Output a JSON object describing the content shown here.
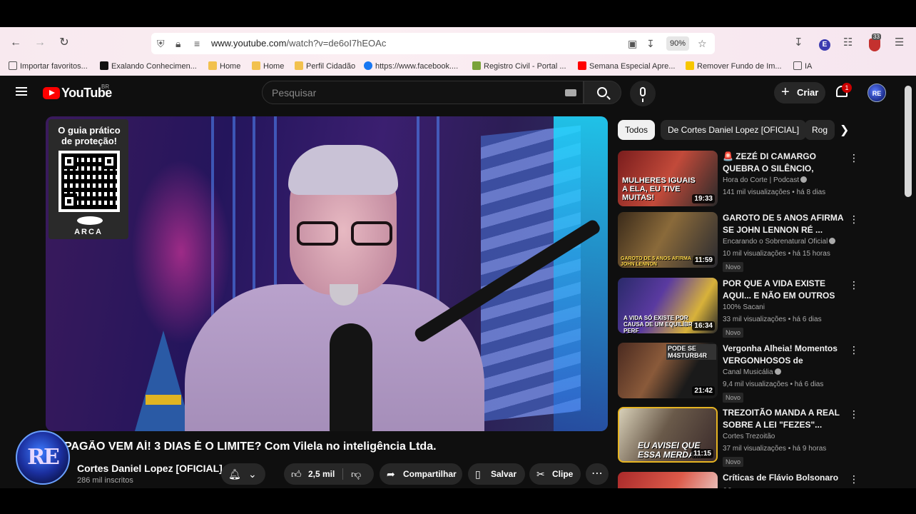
{
  "browser": {
    "url_domain": "www.youtube.com",
    "url_path": "/watch?v=de6oI7hEOAc",
    "zoom": "90%",
    "extension_badge_count": "33",
    "bookmarks": [
      {
        "label": "Importar favoritos...",
        "icon": "import-icon",
        "color": "#555555"
      },
      {
        "label": "Exalando Conhecimen...",
        "icon": "x-icon",
        "color": "#111111"
      },
      {
        "label": "Home",
        "icon": "hand-icon",
        "color": "#f2c14e"
      },
      {
        "label": "Home",
        "icon": "hand-icon",
        "color": "#f2c14e"
      },
      {
        "label": "Perfil Cidadão",
        "icon": "hand-icon",
        "color": "#f2c14e"
      },
      {
        "label": "https://www.facebook....",
        "icon": "facebook-icon",
        "color": "#1877f2"
      },
      {
        "label": "Registro Civil - Portal ...",
        "icon": "portal-icon",
        "color": "#7aa33a"
      },
      {
        "label": "Semana Especial Apre...",
        "icon": "youtube-icon",
        "color": "#ff0000"
      },
      {
        "label": "Remover Fundo de Im...",
        "icon": "remove-bg-icon",
        "color": "#f7c600"
      },
      {
        "label": "IA",
        "icon": "folder-icon",
        "color": "#555555"
      }
    ]
  },
  "youtube": {
    "logo_text": "YouTube",
    "region": "BR",
    "search_placeholder": "Pesquisar",
    "create_label": "Criar",
    "notification_count": "1",
    "avatar_text": "RE"
  },
  "video": {
    "title": "PAGÃO VEM AÍ! 3 DIAS É O LIMITE? Com Vilela no inteligência Ltda.",
    "overlay": {
      "card_title": "O guia prático de proteção!",
      "brand": "ARCA"
    },
    "channel_name": "Cortes Daniel Lopez [OFICIAL]",
    "subscribers": "286 mil inscritos",
    "channel_avatar_text": "RE",
    "likes": "2,5 mil",
    "share_label": "Compartilhar",
    "save_label": "Salvar",
    "clip_label": "Clipe"
  },
  "sidebar": {
    "chips": [
      "Todos",
      "De Cortes Daniel Lopez [OFICIAL]",
      "Rog"
    ],
    "recommendations": [
      {
        "title": "🚨 ZEZÉ DI CAMARGO QUEBRA O SILÊNCIO, ASSUME TRAIÇÃ...",
        "channel": "Hora do Corte | Podcast",
        "views": "141 mil visualizações",
        "age": "há 8 dias",
        "duration": "19:33",
        "badge": "",
        "thumb_text": "MULHERES IGUAIS A ELA, EU TIVE MUITAS!"
      },
      {
        "title": "GAROTO DE 5 ANOS AFIRMA SE JOHN LENNON RÉ ...",
        "channel": "Encarando o Sobrenatural Oficial",
        "views": "10 mil visualizações",
        "age": "há 15 horas",
        "duration": "11:59",
        "badge": "Novo",
        "thumb_text": "GAROTO DE 5 ANOS AFIRMA SER JOHN LENNON"
      },
      {
        "title": "POR QUE A VIDA EXISTE AQUI... E NÃO EM OUTROS LUGARES?",
        "channel": "100% Sacani",
        "views": "33 mil visualizações",
        "age": "há 6 dias",
        "duration": "16:34",
        "badge": "Novo",
        "thumb_text": "A VIDA SÓ EXISTE POR CAUSA DE UM EQUILÍBRIO PERF"
      },
      {
        "title": "Vergonha Alheia! Momentos VERGONHOSOS de MÚSICOS ...",
        "channel": "Canal Musicália",
        "views": "9,4 mil visualizações",
        "age": "há 6 dias",
        "duration": "21:42",
        "badge": "Novo",
        "thumb_text": "PODE SE M4STURB4R"
      },
      {
        "title": "TREZOITÃO MANDA A REAL SOBRE A LEI \"FEZES\"...",
        "channel": "Cortes Trezoitão",
        "views": "37 mil visualizações",
        "age": "há 9 horas",
        "duration": "11:15",
        "badge": "Novo",
        "thumb_text": "EU AVISEI QUE ESSA MERDA..."
      },
      {
        "title": "Críticas de Flávio Bolsonaro as",
        "channel": "",
        "views": "",
        "age": "",
        "duration": "",
        "badge": "",
        "thumb_text": ""
      }
    ]
  }
}
